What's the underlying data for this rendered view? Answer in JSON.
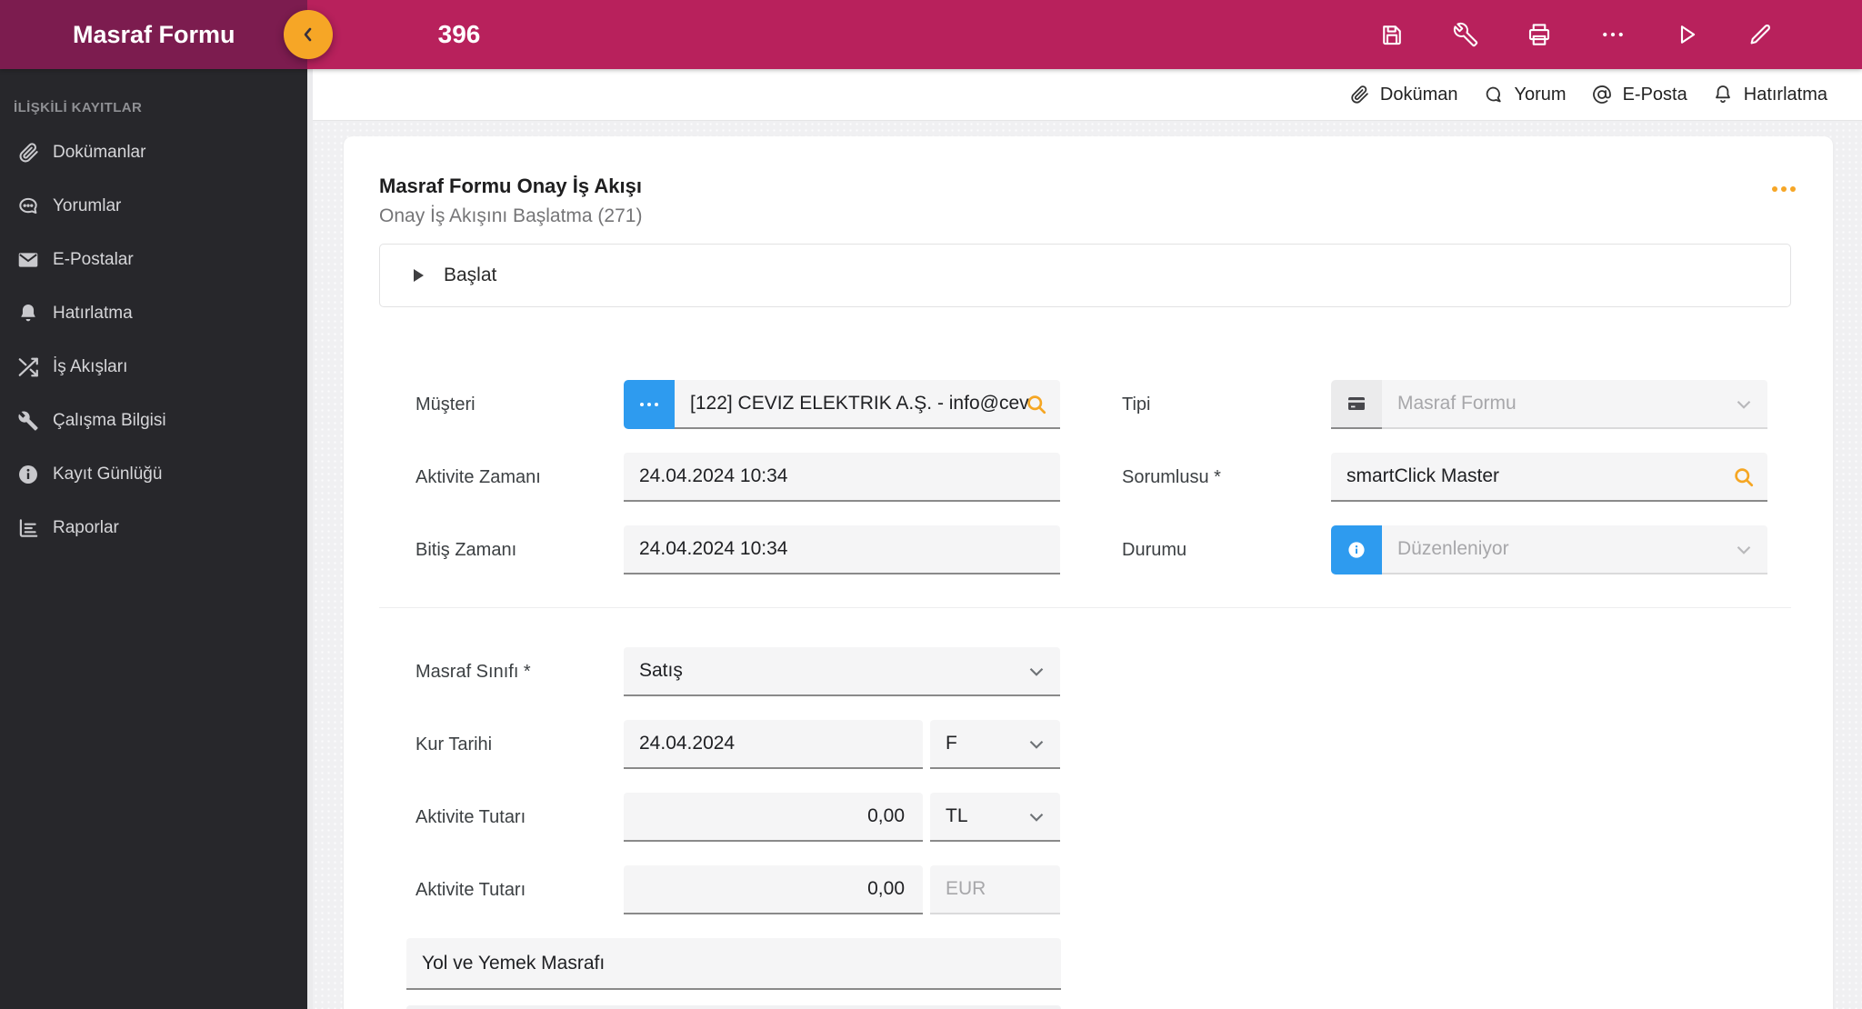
{
  "topbar": {
    "title": "Masraf Formu",
    "record_number": "396",
    "action_icons": [
      "save-icon",
      "wrench-icon",
      "print-icon",
      "more-icon",
      "run-icon",
      "edit-icon"
    ]
  },
  "quickbar": {
    "items": [
      {
        "icon": "paperclip-icon",
        "label": "Doküman"
      },
      {
        "icon": "comment-icon",
        "label": "Yorum"
      },
      {
        "icon": "at-sign-icon",
        "label": "E-Posta"
      },
      {
        "icon": "bell-icon",
        "label": "Hatırlatma"
      }
    ]
  },
  "sidebar": {
    "header": "İLİŞKİLİ KAYITLAR",
    "items": [
      {
        "icon": "paperclip-icon",
        "label": "Dokümanlar"
      },
      {
        "icon": "comment-icon",
        "label": "Yorumlar"
      },
      {
        "icon": "envelope-icon",
        "label": "E-Postalar"
      },
      {
        "icon": "bell-icon",
        "label": "Hatırlatma"
      },
      {
        "icon": "shuffle-icon",
        "label": "İş Akışları"
      },
      {
        "icon": "wrench-icon",
        "label": "Çalışma Bilgisi"
      },
      {
        "icon": "info-icon",
        "label": "Kayıt Günlüğü"
      },
      {
        "icon": "report-icon",
        "label": "Raporlar"
      }
    ]
  },
  "workflow": {
    "title": "Masraf Formu Onay İş Akışı",
    "subtitle": "Onay İş Akışını Başlatma (271)",
    "start_button": "Başlat",
    "more_icon": "more-icon"
  },
  "form": {
    "musteri": {
      "label": "Müşteri",
      "value": "[122] CEVIZ ELEKTRIK A.Ş.  - info@cev"
    },
    "tipi": {
      "label": "Tipi",
      "value": "Masraf Formu"
    },
    "aktivite_zamani": {
      "label": "Aktivite Zamanı",
      "value": "24.04.2024 10:34"
    },
    "sorumlusu": {
      "label": "Sorumlusu *",
      "value": "smartClick Master"
    },
    "bitis_zamani": {
      "label": "Bitiş Zamanı",
      "value": "24.04.2024 10:34"
    },
    "durumu": {
      "label": "Durumu",
      "value": "Düzenleniyor"
    },
    "masraf_sinifi": {
      "label": "Masraf Sınıfı *",
      "value": "Satış"
    },
    "kur_tarihi": {
      "label": "Kur Tarihi",
      "value": "24.04.2024",
      "currency": "F"
    },
    "aktivite_tutari_tl": {
      "label": "Aktivite Tutarı",
      "value": "0,00",
      "currency": "TL"
    },
    "aktivite_tutari_eur": {
      "label": "Aktivite Tutarı",
      "value": "0,00",
      "currency": "EUR"
    },
    "aciklama": {
      "value": "Yol ve Yemek Masrafı"
    }
  },
  "colors": {
    "topbar": "#b8215c",
    "topbar_left": "#7c1c4f",
    "accent_orange": "#f6a626",
    "accent_blue": "#2e9bef",
    "sidebar_bg": "#27272b",
    "field_bg": "#f5f5f6",
    "field_border": "#8a8a8a",
    "main_bg": "#f0f0f2"
  }
}
